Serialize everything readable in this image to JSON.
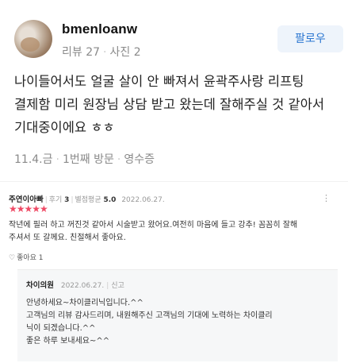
{
  "review": {
    "username": "bmenloanw",
    "stats": {
      "reviews": "리뷰 27",
      "photos": "사진 2"
    },
    "follow_label": "팔로우",
    "text": "나이들어서도 얼굴 살이 안 빠져서 윤곽주사랑 리프팅 결제함 미리 원장님 상담 받고 왔는데 잘해주실 것 같아서 기대중이에요 ㅎㅎ",
    "meta": {
      "date": "11.4.금",
      "visit": "1번째 방문",
      "receipt": "영수증"
    }
  },
  "embedded_review": {
    "nickname": "주연이아빠",
    "reviews_count": "후기 3",
    "avg_label": "별점평균",
    "avg_value": "5.0",
    "date": "2022.06.27.",
    "stars": "★★★★★",
    "more_label": "⋮",
    "body_line1": "작년에 필러 하고 꺼진것 같아서 시술받고 왔어요.여전히 마음에 들고 강추! 꼼꼼히 잘해",
    "body_line2": "주셔서 또 갈께요. 친절해서 좋아요.",
    "like_label": "좋아요 1",
    "reply": {
      "owner": "차이의원",
      "date": "2022.06.27.",
      "report_label": "신고",
      "lines": [
        "안녕하세요~차이클리닉입니다.^^",
        "고객님의 리뷰 감사드리며, 내원해주신 고객님의 기대에 노력하는 차이클리",
        "닉이 되겠습니다.^^",
        "좋은 하루 보내세요~^^"
      ]
    }
  },
  "colors": {
    "accent": "#2a76d1",
    "follow_bg": "#eef4fb",
    "star": "#ef4a65",
    "muted": "#8a8a8a"
  }
}
